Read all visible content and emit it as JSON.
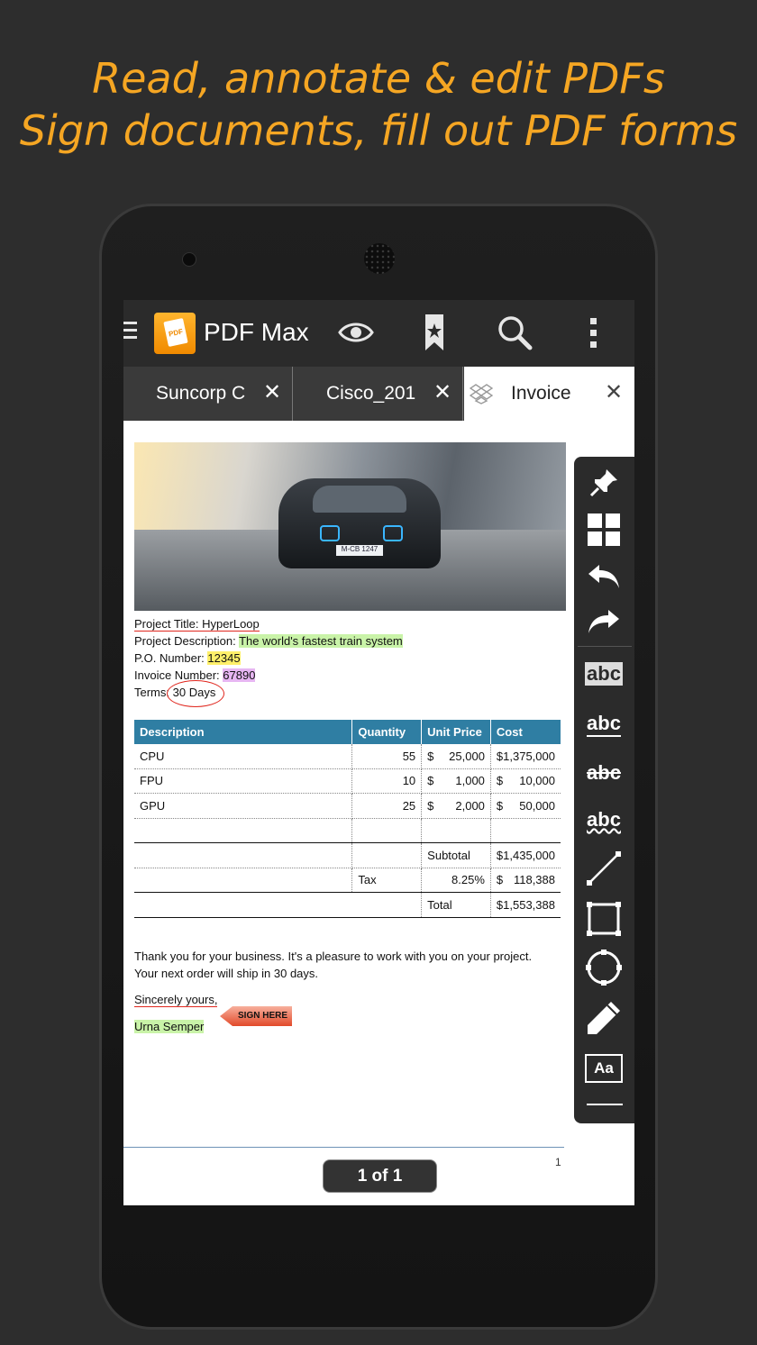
{
  "headline": {
    "line1": "Read, annotate & edit PDFs",
    "line2": "Sign documents, fill out PDF forms"
  },
  "app": {
    "name": "PDF Max",
    "logo_text": "PDF"
  },
  "toolbar_icons": [
    "menu-icon",
    "eye-icon",
    "bookmark-icon",
    "search-icon",
    "more-vertical-icon"
  ],
  "tabs": [
    {
      "label": "Suncorp C",
      "active": false
    },
    {
      "label": "Cisco_201",
      "active": false
    },
    {
      "label": "Invoice",
      "active": true
    }
  ],
  "document": {
    "car_plate": "M-CB 1247",
    "fields": {
      "project_title_label": "Project Title:",
      "project_title_value": "HyperLoop",
      "project_desc_label": "Project Description:",
      "project_desc_value": "The world's fastest train system",
      "po_label": "P.O. Number:",
      "po_value": "12345",
      "invoice_label": "Invoice Number:",
      "invoice_value": "67890",
      "terms_label": "Terms:",
      "terms_value": "30 Days"
    },
    "table": {
      "headers": [
        "Description",
        "Quantity",
        "Unit Price",
        "Cost"
      ],
      "rows": [
        {
          "desc": "CPU",
          "qty": "55",
          "unit_sym": "$",
          "unit": "25,000",
          "cost": "$1,375,000"
        },
        {
          "desc": "FPU",
          "qty": "10",
          "unit_sym": "$",
          "unit": "1,000",
          "cost_sym": "$",
          "cost": "10,000"
        },
        {
          "desc": "GPU",
          "qty": "25",
          "unit_sym": "$",
          "unit": "2,000",
          "cost_sym": "$",
          "cost": "50,000"
        }
      ],
      "subtotal_label": "Subtotal",
      "subtotal_value": "$1,435,000",
      "tax_label": "Tax",
      "tax_rate": "8.25%",
      "tax_sym": "$",
      "tax_value": "118,388",
      "total_label": "Total",
      "total_value": "$1,553,388"
    },
    "thanks_line1": "Thank you for your business. It's a pleasure to work with you on your project.",
    "thanks_line2": "Your next order will ship in 30 days.",
    "closing": "Sincerely yours,",
    "signer": "Urna Semper",
    "sign_here": "SIGN HERE",
    "page_number": "1",
    "page_indicator": "1 of 1"
  },
  "side_tools": [
    "pin-icon",
    "grid-icon",
    "undo-icon",
    "redo-icon",
    "highlight-text-icon",
    "underline-text-icon",
    "strikeout-text-icon",
    "squiggly-text-icon",
    "line-icon",
    "rectangle-icon",
    "circle-icon",
    "pencil-icon",
    "textbox-icon"
  ],
  "side_tool_labels": {
    "highlight": "abc",
    "underline": "abc",
    "strikeout": "abc",
    "squiggly": "abc",
    "textbox": "Aa"
  },
  "colors": {
    "headline": "#f5a623",
    "table_header": "#2f7ea3",
    "annotation_red": "#e0271e",
    "highlight_green": "#c9f3a8",
    "highlight_yellow": "#fff06a",
    "highlight_purple": "#e7b6f2"
  }
}
